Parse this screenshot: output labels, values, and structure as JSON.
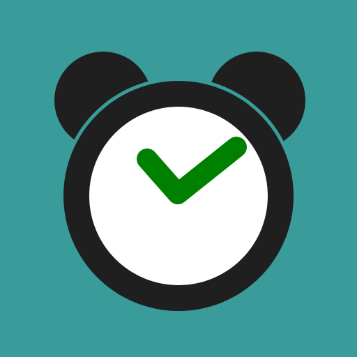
{
  "icon": {
    "name": "alarm-clock-check-icon",
    "colors": {
      "background": "#399c9a",
      "clock_body": "#1f1f1f",
      "clock_face": "#ffffff",
      "checkmark": "#008000"
    }
  }
}
